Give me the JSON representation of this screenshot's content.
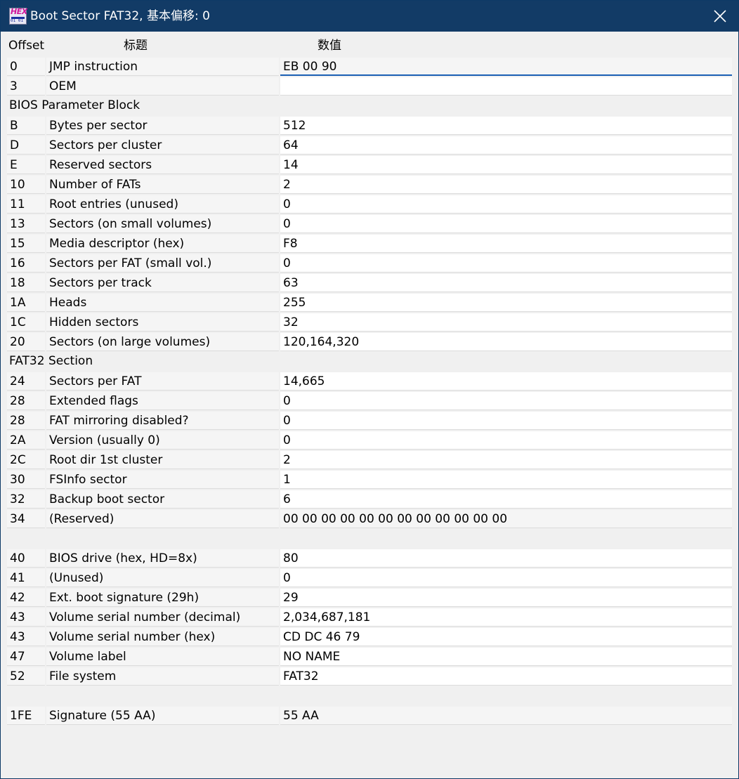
{
  "window": {
    "title": "Boot Sector FAT32, 基本偏移: 0",
    "icon": "hex-editor-app-icon",
    "icon_text": "HEX"
  },
  "columns": {
    "offset": "Offset",
    "title": "标题",
    "value": "数值"
  },
  "sections": [
    {
      "label": "",
      "rows": [
        {
          "offset": "0",
          "name": "JMP instruction",
          "value": "EB 00 90",
          "state": "focused"
        },
        {
          "offset": "3",
          "name": "OEM",
          "value": "",
          "state": "editable"
        }
      ]
    },
    {
      "label": "BIOS Parameter Block",
      "rows": [
        {
          "offset": "B",
          "name": "Bytes per sector",
          "value": "512",
          "state": "editable"
        },
        {
          "offset": "D",
          "name": "Sectors per cluster",
          "value": "64",
          "state": "editable"
        },
        {
          "offset": "E",
          "name": "Reserved sectors",
          "value": "14",
          "state": "editable"
        },
        {
          "offset": "10",
          "name": "Number of FATs",
          "value": "2",
          "state": "editable"
        },
        {
          "offset": "11",
          "name": "Root entries (unused)",
          "value": "0",
          "state": "editable"
        },
        {
          "offset": "13",
          "name": "Sectors (on small volumes)",
          "value": "0",
          "state": "editable"
        },
        {
          "offset": "15",
          "name": "Media descriptor (hex)",
          "value": "F8",
          "state": "editable"
        },
        {
          "offset": "16",
          "name": "Sectors per FAT (small vol.)",
          "value": "0",
          "state": "editable"
        },
        {
          "offset": "18",
          "name": "Sectors per track",
          "value": "63",
          "state": "editable"
        },
        {
          "offset": "1A",
          "name": "Heads",
          "value": "255",
          "state": "editable"
        },
        {
          "offset": "1C",
          "name": "Hidden sectors",
          "value": "32",
          "state": "editable"
        },
        {
          "offset": "20",
          "name": "Sectors (on large volumes)",
          "value": "120,164,320",
          "state": "editable"
        }
      ]
    },
    {
      "label": "FAT32 Section",
      "rows": [
        {
          "offset": "24",
          "name": "Sectors per FAT",
          "value": "14,665",
          "state": "editable"
        },
        {
          "offset": "28",
          "name": "Extended flags",
          "value": "0",
          "state": "editable"
        },
        {
          "offset": "28",
          "name": "FAT mirroring disabled?",
          "value": "0",
          "state": "editable"
        },
        {
          "offset": "2A",
          "name": "Version (usually 0)",
          "value": "0",
          "state": "editable"
        },
        {
          "offset": "2C",
          "name": "Root dir 1st cluster",
          "value": "2",
          "state": "editable"
        },
        {
          "offset": "30",
          "name": "FSInfo sector",
          "value": "1",
          "state": "editable"
        },
        {
          "offset": "32",
          "name": "Backup boot sector",
          "value": "6",
          "state": "editable"
        },
        {
          "offset": "34",
          "name": "(Reserved)",
          "value": "00 00 00 00 00 00 00 00 00 00 00 00",
          "state": "readonly"
        }
      ]
    },
    {
      "label": "",
      "rows": [
        {
          "offset": "40",
          "name": "BIOS drive (hex, HD=8x)",
          "value": "80",
          "state": "editable"
        },
        {
          "offset": "41",
          "name": "(Unused)",
          "value": "0",
          "state": "editable"
        },
        {
          "offset": "42",
          "name": "Ext. boot signature (29h)",
          "value": "29",
          "state": "editable"
        },
        {
          "offset": "43",
          "name": "Volume serial number (decimal)",
          "value": "2,034,687,181",
          "state": "editable"
        },
        {
          "offset": "43",
          "name": "Volume serial number (hex)",
          "value": "CD DC 46 79",
          "state": "editable"
        },
        {
          "offset": "47",
          "name": "Volume label",
          "value": "NO NAME",
          "state": "editable"
        },
        {
          "offset": "52",
          "name": "File system",
          "value": "FAT32",
          "state": "editable"
        }
      ]
    },
    {
      "label": "",
      "rows": [
        {
          "offset": "1FE",
          "name": "Signature (55 AA)",
          "value": "55 AA",
          "state": "readonly"
        }
      ]
    }
  ]
}
